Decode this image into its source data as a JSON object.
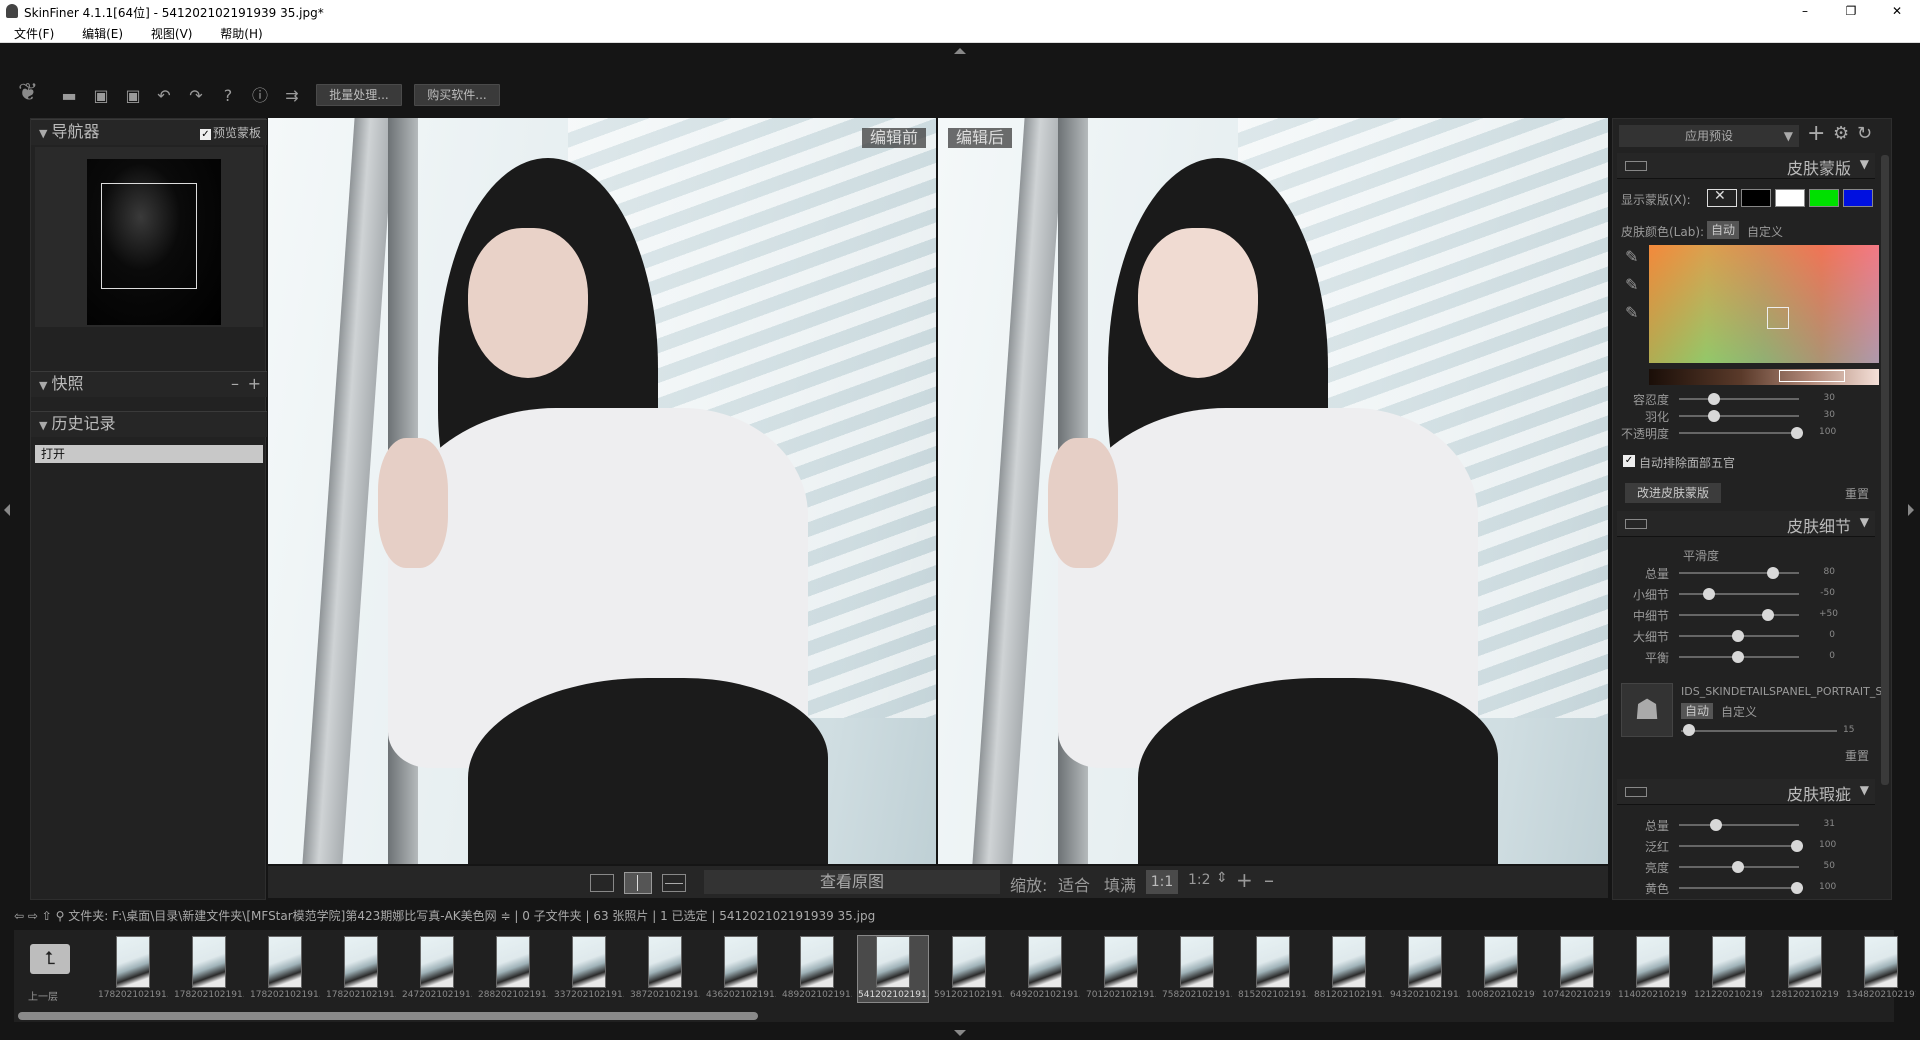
{
  "window": {
    "title": "SkinFiner 4.1.1[64位] - 541202102191939 35.jpg*",
    "minimize": "–",
    "maximize": "❐",
    "close": "✕"
  },
  "menu": [
    "文件(F)",
    "编辑(E)",
    "视图(V)",
    "帮助(H)"
  ],
  "toolbar": {
    "batch_label": "批量处理...",
    "buy_label": "购买软件..."
  },
  "navigator": {
    "title": "导航器",
    "preview_mask_label": "预览蒙板",
    "preview_mask_checked": true
  },
  "snapshot": {
    "title": "快照"
  },
  "history": {
    "title": "历史记录",
    "items": [
      "打开"
    ]
  },
  "compare": {
    "before_label": "编辑前",
    "after_label": "编辑后"
  },
  "viewbar": {
    "view_original_label": "查看原图",
    "zoom_label": "缩放:",
    "fit_label": "适合",
    "fill_label": "填满",
    "ratio_1": "1:1",
    "ratio_2": "1:2"
  },
  "presets": {
    "label": "应用预设"
  },
  "skin_mask": {
    "title": "皮肤蒙版",
    "show_mask_label": "显示蒙版(X):",
    "skin_color_label": "皮肤颜色(Lab):",
    "auto_label": "自动",
    "custom_label": "自定义",
    "swatch_colors": [
      "#000000",
      "#ffffff",
      "#00e000",
      "#0010e0"
    ],
    "sliders": [
      {
        "label": "容忍度",
        "value": "30",
        "level": 0.3
      },
      {
        "label": "羽化",
        "value": "30",
        "level": 0.3
      },
      {
        "label": "不透明度",
        "value": "100",
        "level": 1.0
      }
    ],
    "exclude_label": "自动排除面部五官",
    "exclude_checked": true,
    "improve_label": "改进皮肤蒙版",
    "reset_label": "重置"
  },
  "skin_detail": {
    "title": "皮肤细节",
    "smooth_label": "平滑度",
    "sliders": [
      {
        "label": "总量",
        "value": "80",
        "level": 0.8
      },
      {
        "label": "小细节",
        "value": "-50",
        "level": 0.25
      },
      {
        "label": "中细节",
        "value": "+50",
        "level": 0.75
      },
      {
        "label": "大细节",
        "value": "0",
        "level": 0.5
      },
      {
        "label": "平衡",
        "value": "0",
        "level": 0.5
      }
    ],
    "portrait_label": "IDS_SKINDETAILSPANEL_PORTRAIT_S...",
    "auto_label": "自动",
    "custom_label": "自定义",
    "portrait_value": "15",
    "portrait_level": 0.05,
    "reset_label": "重置"
  },
  "skin_blemish": {
    "title": "皮肤瑕疵",
    "sliders": [
      {
        "label": "总量",
        "value": "31",
        "level": 0.31
      },
      {
        "label": "泛红",
        "value": "100",
        "level": 1.0
      },
      {
        "label": "亮度",
        "value": "50",
        "level": 0.5
      },
      {
        "label": "黄色",
        "value": "100",
        "level": 1.0
      }
    ]
  },
  "pathbar": {
    "text": "文件夹:  F:\\桌面\\目录\\新建文件夹\\[MFStar模范学院]第423期娜比写真-AK美色网 ≑ | 0 子文件夹 | 63 张照片 | 1 已选定 | 541202102191939 35.jpg"
  },
  "filmstrip": {
    "up_label": "上一层",
    "items": [
      "178202102191...",
      "178202102191...",
      "178202102191...",
      "178202102191...",
      "247202102191...",
      "288202102191...",
      "337202102191...",
      "387202102191...",
      "436202102191...",
      "489202102191...",
      "541202102191...",
      "591202102191...",
      "649202102191...",
      "701202102191...",
      "758202102191...",
      "815202102191...",
      "881202102191...",
      "943202102191...",
      "1008202102191...",
      "1074202102191...",
      "1140202102191...",
      "1212202102191...",
      "1281202102191...",
      "1348202102191..."
    ],
    "selected_index": 10
  }
}
